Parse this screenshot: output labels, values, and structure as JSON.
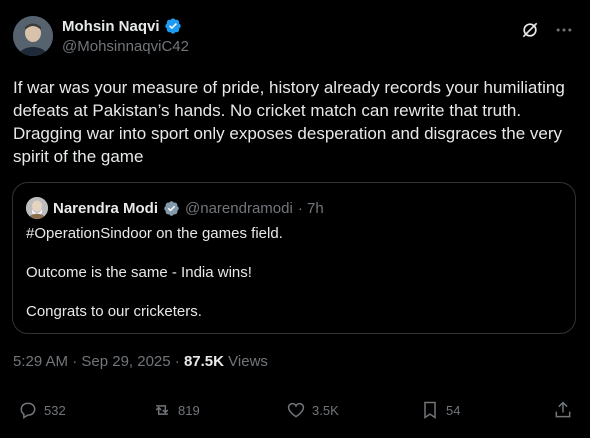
{
  "author": {
    "name": "Mohsin Naqvi",
    "handle": "@MohsinnaqviC42",
    "verified_color": "#1d9bf0"
  },
  "post": {
    "text": "If war was your measure of pride, history already records your humiliating defeats at Pakistan’s hands. No cricket match can rewrite that truth. Dragging war into sport only exposes desperation and disgraces the very spirit of the game"
  },
  "quote": {
    "name": "Narendra Modi",
    "handle": "@narendramodi",
    "time": "· 7h",
    "verified_color": "#829aab",
    "lines": [
      "#OperationSindoor on the games field.",
      "Outcome is the same - India wins!",
      "Congrats to our cricketers."
    ]
  },
  "meta": {
    "time_date": "5:29 AM · Sep 29, 2025 ·",
    "views_count": "87.5K",
    "views_label": "Views"
  },
  "actions": {
    "replies": "532",
    "reposts": "819",
    "likes": "3.5K",
    "bookmarks": "54"
  },
  "icons": {
    "grok": "grok-icon",
    "more": "more-icon",
    "reply": "reply-icon",
    "repost": "repost-icon",
    "like": "heart-icon",
    "bookmark": "bookmark-icon",
    "share": "share-icon"
  }
}
